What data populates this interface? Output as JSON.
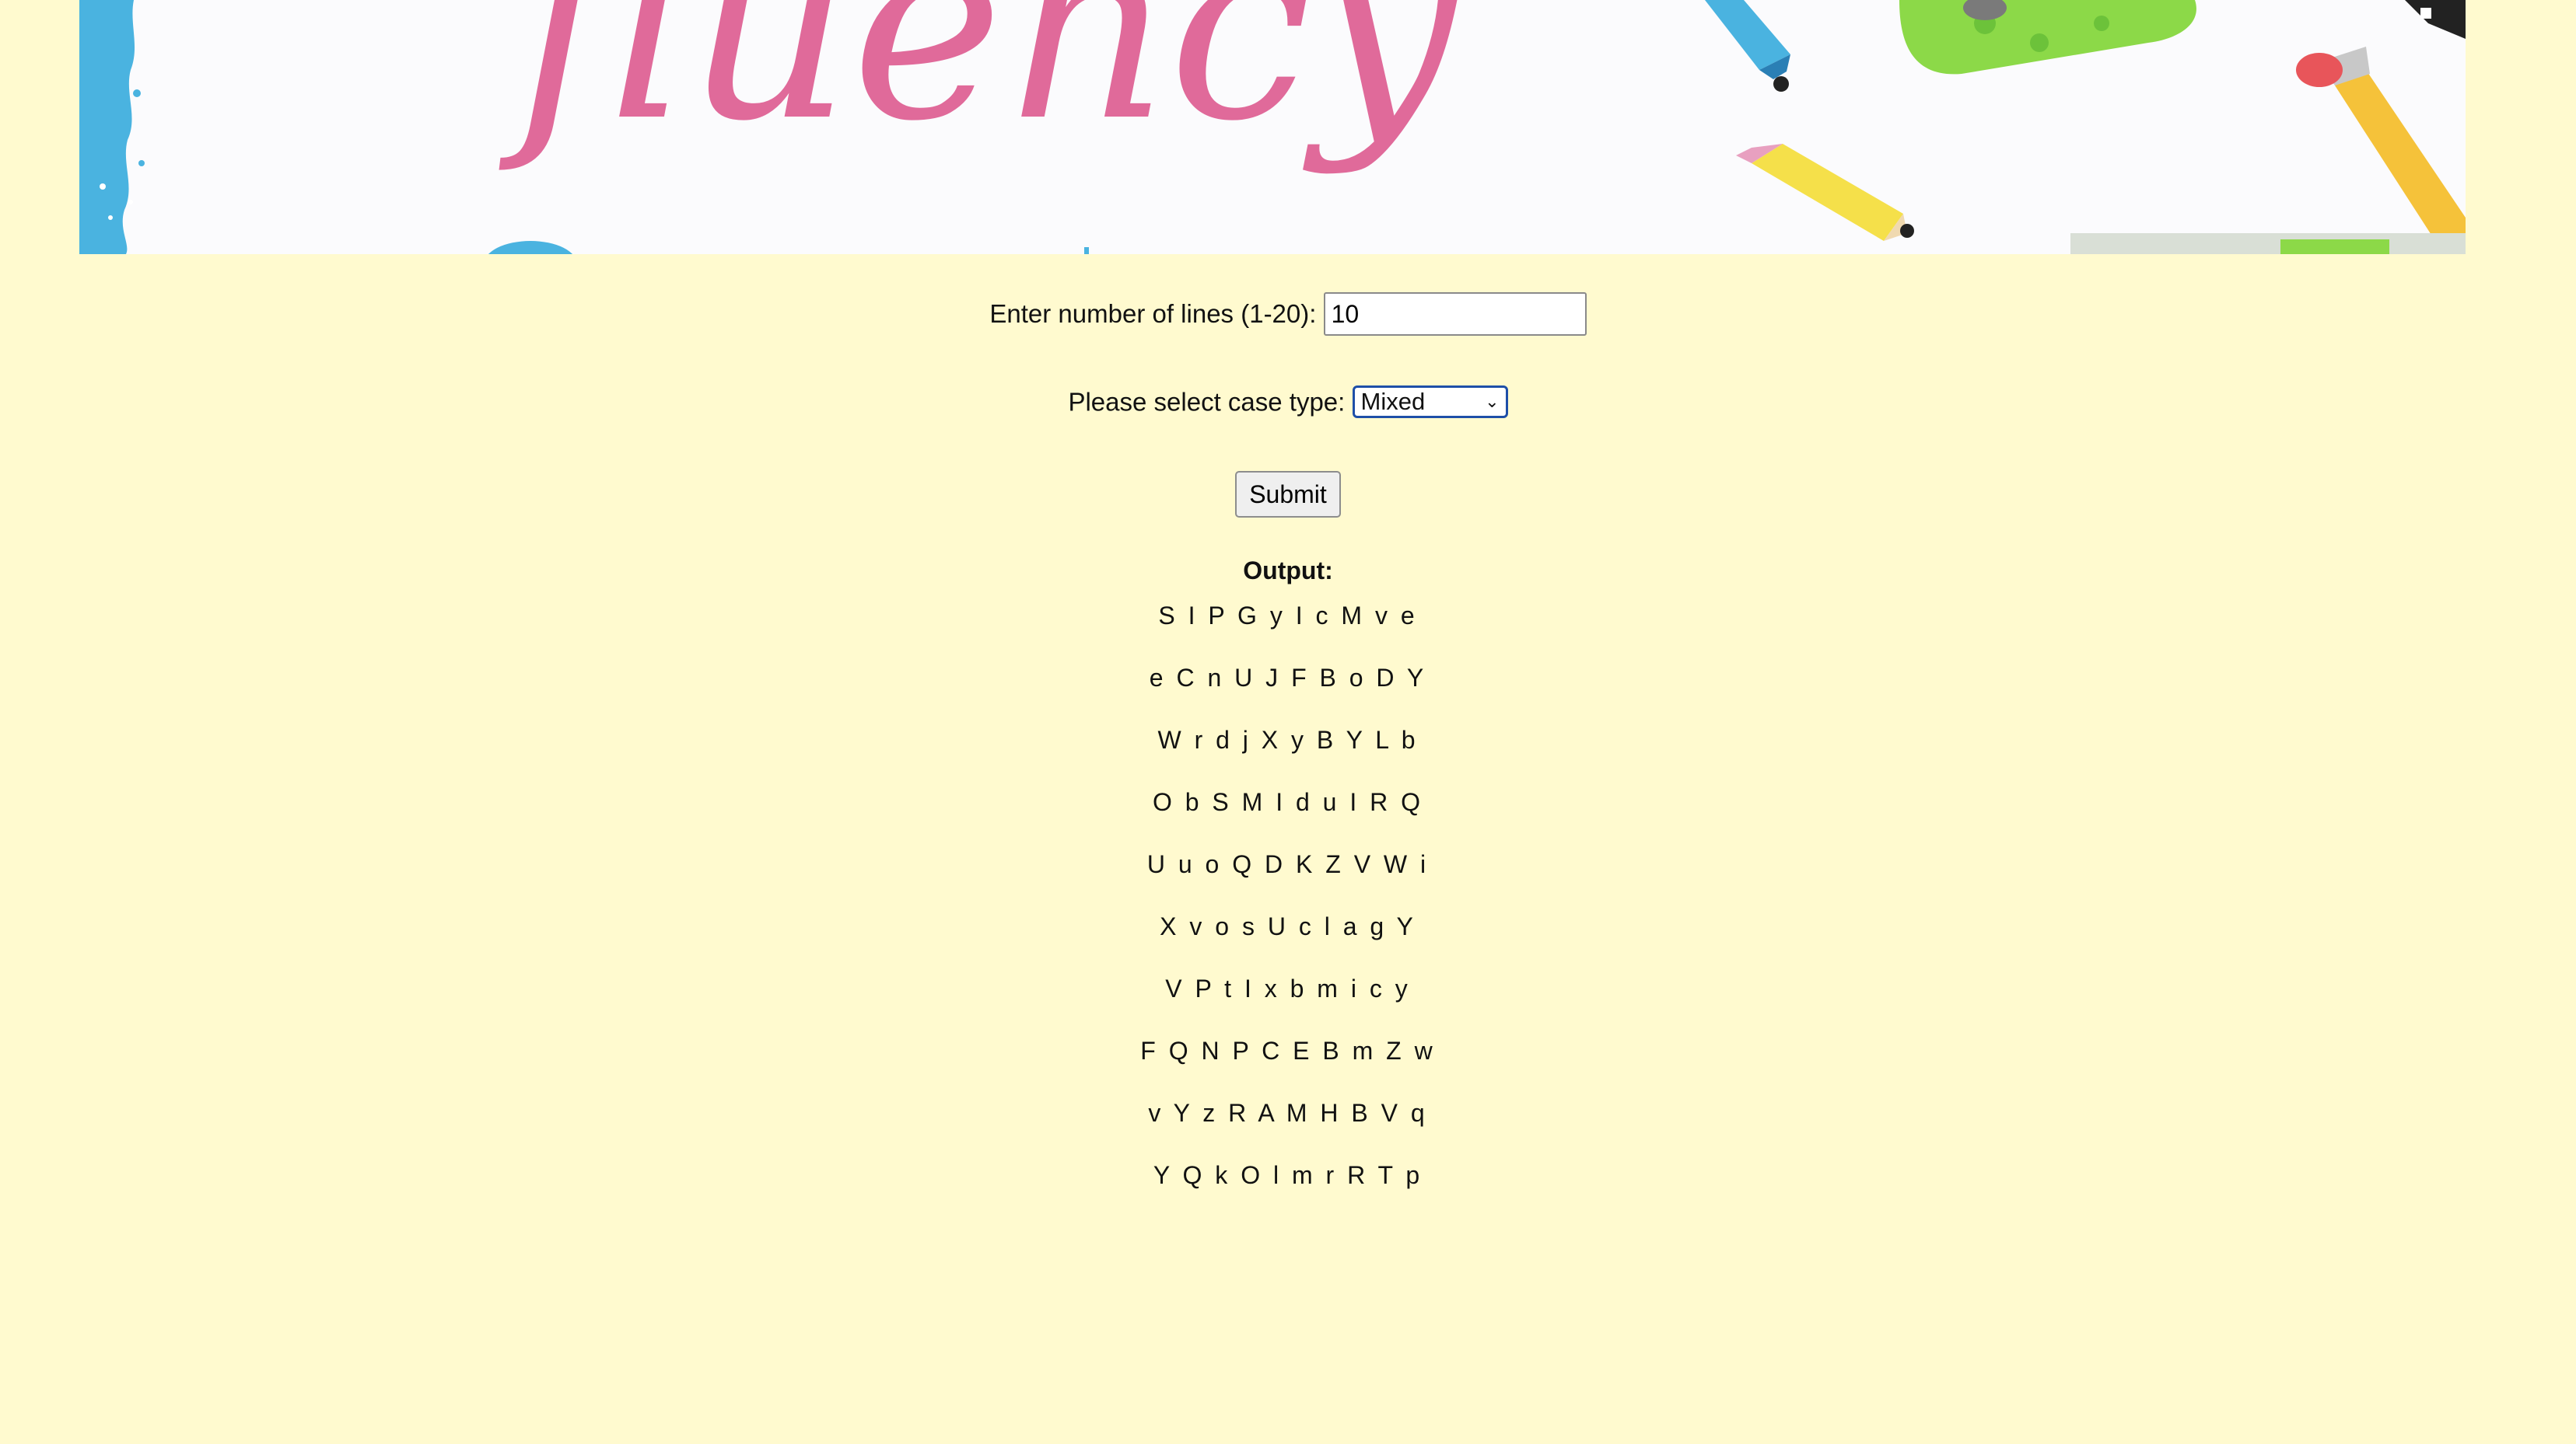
{
  "banner": {
    "title_partial": "fluency",
    "icons": [
      "blue-paint-edge",
      "pencil-icon",
      "eraser-icon"
    ]
  },
  "form": {
    "lines_label": "Enter number of lines (1-20):",
    "lines_value": "10",
    "case_label": "Please select case type:",
    "case_value": "Mixed",
    "submit_label": "Submit"
  },
  "output": {
    "title": "Output:",
    "lines": [
      "S I P G y I c M v e",
      "e C n U J F B o D Y",
      "W r d j X y B Y L b",
      "O b S M I d u I R Q",
      "U u o Q D K Z V W i",
      "X v o s U c l a g Y",
      "V P t I x b m i c y",
      "F Q N P C E B m Z w",
      "v Y z R A M H B V q",
      "Y Q k O l m r R T p"
    ]
  },
  "colors": {
    "background": "#fffacf",
    "title_pink": "#e06a9a",
    "accent_blue": "#4ab3e0",
    "select_border": "#1e4fa8"
  }
}
